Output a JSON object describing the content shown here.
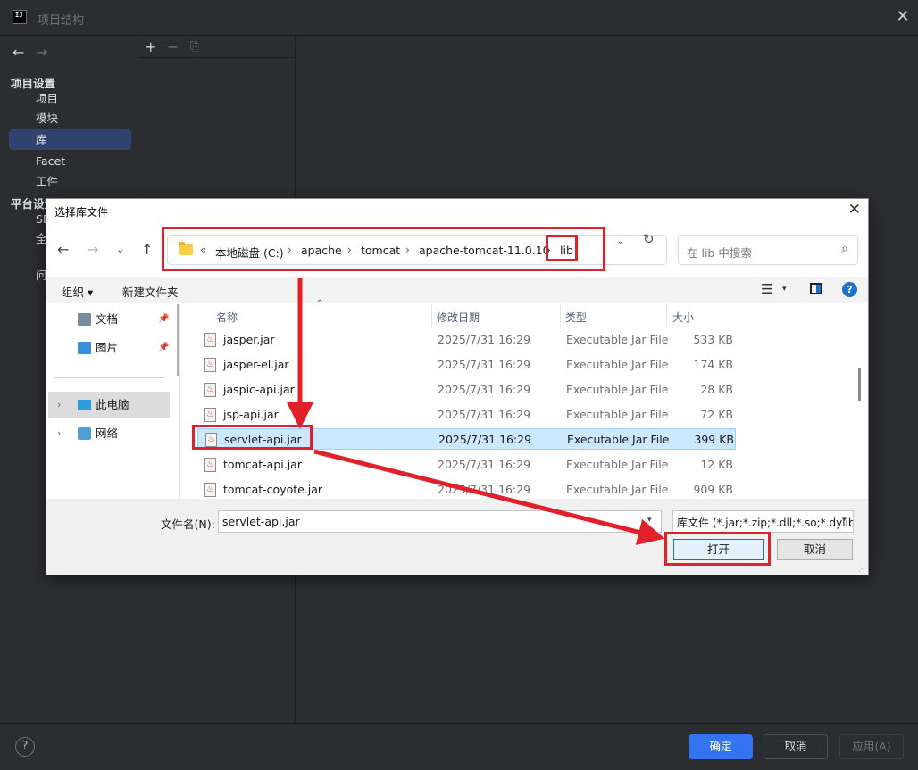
{
  "ide": {
    "title": "项目结构",
    "app_icon": "IJ",
    "close": "✕",
    "nav_back": "←",
    "nav_forward": "→",
    "sections": [
      {
        "label": "项目设置",
        "items": [
          "项目",
          "模块",
          "库",
          "Facet",
          "工件"
        ]
      },
      {
        "label": "平台设置",
        "items": [
          "SD",
          "全"
        ]
      }
    ],
    "extra_item": "问",
    "selected_item": "库",
    "toolbar": {
      "add": "+",
      "remove": "−",
      "copy": "⎘"
    },
    "help": "?",
    "buttons": {
      "ok": "确定",
      "cancel": "取消",
      "apply": "应用(A)"
    },
    "accent_color": "#3574f0"
  },
  "file_dialog": {
    "title": "选择库文件",
    "close": "✕",
    "nav": {
      "back": "←",
      "forward": "→",
      "recent": "⌄",
      "up": "↑"
    },
    "breadcrumb": [
      "本地磁盘 (C:)",
      "apache",
      "tomcat",
      "apache-tomcat-11.0.10",
      "lib"
    ],
    "breadcrumb_prefix": "«",
    "breadcrumb_separator": "›",
    "address_dropdown": "⌄",
    "refresh": "↻",
    "search_placeholder": "在 lib 中搜索",
    "search_icon": "⌕",
    "organize": "组织 ▾",
    "new_folder": "新建文件夹",
    "view_icon": "☰",
    "view_caret": "▾",
    "help_icon": "?",
    "left_pane": [
      {
        "label": "文档",
        "icon": "document-icon",
        "pinned": true
      },
      {
        "label": "图片",
        "icon": "pictures-icon",
        "pinned": true
      },
      {
        "label": "此电脑",
        "icon": "computer-icon",
        "expandable": true,
        "selected": true
      },
      {
        "label": "网络",
        "icon": "network-icon",
        "expandable": true
      }
    ],
    "pin_glyph": "📌",
    "chevron_glyph": "›",
    "columns": {
      "name": "名称",
      "modified": "修改日期",
      "type": "类型",
      "size": "大小"
    },
    "sort_caret": "^",
    "files": [
      {
        "name": "jasper.jar",
        "modified": "2025/7/31 16:29",
        "type": "Executable Jar File",
        "size": "533 KB"
      },
      {
        "name": "jasper-el.jar",
        "modified": "2025/7/31 16:29",
        "type": "Executable Jar File",
        "size": "174 KB"
      },
      {
        "name": "jaspic-api.jar",
        "modified": "2025/7/31 16:29",
        "type": "Executable Jar File",
        "size": "28 KB"
      },
      {
        "name": "jsp-api.jar",
        "modified": "2025/7/31 16:29",
        "type": "Executable Jar File",
        "size": "72 KB"
      },
      {
        "name": "servlet-api.jar",
        "modified": "2025/7/31 16:29",
        "type": "Executable Jar File",
        "size": "399 KB",
        "selected": true
      },
      {
        "name": "tomcat-api.jar",
        "modified": "2025/7/31 16:29",
        "type": "Executable Jar File",
        "size": "12 KB"
      },
      {
        "name": "tomcat-coyote.jar",
        "modified": "2025/7/31 16:29",
        "type": "Executable Jar File",
        "size": "909 KB"
      }
    ],
    "filename_label": "文件名(N):",
    "filename_value": "servlet-api.jar",
    "filename_caret": "▾",
    "filetype": "库文件 (*.jar;*.zip;*.dll;*.so;*.dylib)",
    "filetype_caret": "▾",
    "open_button": "打开",
    "cancel_button": "取消",
    "grip": "⋰"
  },
  "annotation_color": "#e0202a"
}
